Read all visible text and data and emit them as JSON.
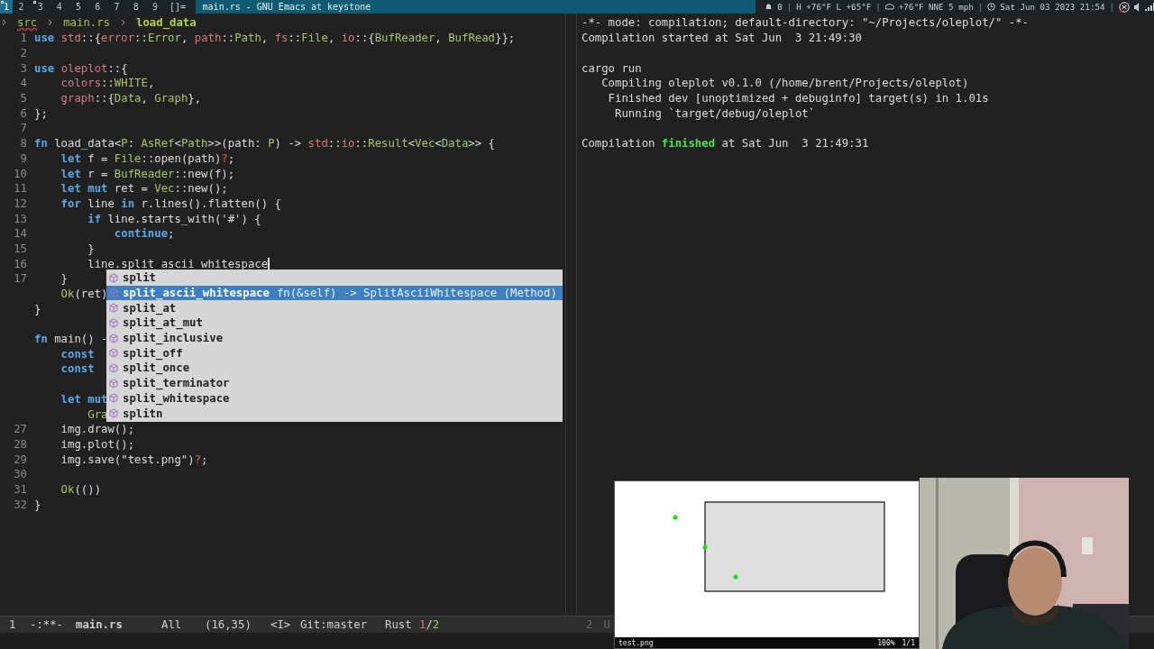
{
  "topbar": {
    "workspaces": [
      {
        "label": "1",
        "selected": true,
        "occupied": true
      },
      {
        "label": "2",
        "selected": false,
        "occupied": false
      },
      {
        "label": "3",
        "selected": false,
        "occupied": true
      },
      {
        "label": "4",
        "selected": false,
        "occupied": false
      },
      {
        "label": "5",
        "selected": false,
        "occupied": false
      },
      {
        "label": "6",
        "selected": false,
        "occupied": false
      },
      {
        "label": "7",
        "selected": false,
        "occupied": false
      },
      {
        "label": "8",
        "selected": false,
        "occupied": false
      },
      {
        "label": "9",
        "selected": false,
        "occupied": false
      }
    ],
    "layout": "[]=",
    "window_title": "main.rs - GNU Emacs at keystone",
    "status": [
      {
        "kind": "text",
        "text": "0"
      },
      {
        "kind": "sep",
        "text": "|"
      },
      {
        "kind": "text",
        "text": "H +76°F L +65°F"
      },
      {
        "kind": "sep",
        "text": "|"
      },
      {
        "kind": "text",
        "text": "+76°F NNE 5 mph"
      },
      {
        "kind": "sep",
        "text": "|"
      },
      {
        "kind": "text",
        "text": "Sat Jun 03 2023 21:54"
      },
      {
        "kind": "sep",
        "text": "|"
      }
    ]
  },
  "editor": {
    "breadcrumb": [
      {
        "text": "src",
        "error": true,
        "current": false
      },
      {
        "text": "main.rs",
        "error": false,
        "current": false
      },
      {
        "text": "load_data",
        "error": false,
        "current": true
      }
    ],
    "blocks": [
      [
        {
          "number": "1",
          "segments": [
            {
              "kind": "kw",
              "text": "use "
            },
            {
              "kind": "ns",
              "text": "std"
            },
            {
              "kind": "plain",
              "text": "::{"
            },
            {
              "kind": "ns",
              "text": "error"
            },
            {
              "kind": "plain",
              "text": "::"
            },
            {
              "kind": "ty",
              "text": "Error"
            },
            {
              "kind": "plain",
              "text": ", "
            },
            {
              "kind": "ns",
              "text": "path"
            },
            {
              "kind": "plain",
              "text": "::"
            },
            {
              "kind": "ty",
              "text": "Path"
            },
            {
              "kind": "plain",
              "text": ", "
            },
            {
              "kind": "ns",
              "text": "fs"
            },
            {
              "kind": "plain",
              "text": "::"
            },
            {
              "kind": "ty",
              "text": "File"
            },
            {
              "kind": "plain",
              "text": ", "
            },
            {
              "kind": "ns",
              "text": "io"
            },
            {
              "kind": "plain",
              "text": "::{"
            },
            {
              "kind": "ty",
              "text": "BufReader"
            },
            {
              "kind": "plain",
              "text": ", "
            },
            {
              "kind": "ty",
              "text": "BufRead"
            },
            {
              "kind": "plain",
              "text": "}};"
            }
          ]
        },
        {
          "number": "2"
        },
        {
          "number": "3",
          "segments": [
            {
              "kind": "kw",
              "text": "use "
            },
            {
              "kind": "ns",
              "text": "oleplot"
            },
            {
              "kind": "plain",
              "text": "::{"
            }
          ]
        },
        {
          "number": "4",
          "segments": [
            {
              "kind": "ns",
              "text": "    colors"
            },
            {
              "kind": "plain",
              "text": "::"
            },
            {
              "kind": "ty",
              "text": "WHITE"
            },
            {
              "kind": "plain",
              "text": ","
            }
          ]
        },
        {
          "number": "5",
          "segments": [
            {
              "kind": "ns",
              "text": "    graph"
            },
            {
              "kind": "plain",
              "text": "::{"
            },
            {
              "kind": "ty",
              "text": "Data"
            },
            {
              "kind": "plain",
              "text": ", "
            },
            {
              "kind": "ty",
              "text": "Graph"
            },
            {
              "kind": "plain",
              "text": "},"
            }
          ]
        },
        {
          "number": "6",
          "segments": [
            {
              "kind": "plain",
              "text": "};"
            }
          ]
        },
        {
          "number": "7"
        },
        {
          "number": "8",
          "segments": [
            {
              "kind": "kw",
              "text": "fn"
            },
            {
              "kind": "plain",
              "text": " load_data<"
            },
            {
              "kind": "ty",
              "text": "P"
            },
            {
              "kind": "plain",
              "text": ": "
            },
            {
              "kind": "ty",
              "text": "AsRef"
            },
            {
              "kind": "plain",
              "text": "<"
            },
            {
              "kind": "ty",
              "text": "Path"
            },
            {
              "kind": "plain",
              "text": ">>(path: "
            },
            {
              "kind": "ty",
              "text": "P"
            },
            {
              "kind": "plain",
              "text": ") -> "
            },
            {
              "kind": "ns",
              "text": "std"
            },
            {
              "kind": "plain",
              "text": "::"
            },
            {
              "kind": "ns",
              "text": "io"
            },
            {
              "kind": "plain",
              "text": "::"
            },
            {
              "kind": "ty",
              "text": "Result"
            },
            {
              "kind": "plain",
              "text": "<"
            },
            {
              "kind": "ty",
              "text": "Vec"
            },
            {
              "kind": "plain",
              "text": "<"
            },
            {
              "kind": "ty",
              "text": "Data"
            },
            {
              "kind": "plain",
              "text": ">> {"
            }
          ]
        },
        {
          "number": "9",
          "segments": [
            {
              "kind": "kw",
              "text": "    let"
            },
            {
              "kind": "plain",
              "text": " f = "
            },
            {
              "kind": "ty",
              "text": "File"
            },
            {
              "kind": "plain",
              "text": "::open(path)"
            },
            {
              "kind": "op",
              "text": "?"
            },
            {
              "kind": "plain",
              "text": ";"
            }
          ]
        },
        {
          "number": "10",
          "segments": [
            {
              "kind": "kw",
              "text": "    let"
            },
            {
              "kind": "plain",
              "text": " r = "
            },
            {
              "kind": "ty",
              "text": "BufReader"
            },
            {
              "kind": "plain",
              "text": "::new(f);"
            }
          ]
        },
        {
          "number": "11",
          "segments": [
            {
              "kind": "kw",
              "text": "    let mut"
            },
            {
              "kind": "plain",
              "text": " ret = "
            },
            {
              "kind": "ty",
              "text": "Vec"
            },
            {
              "kind": "plain",
              "text": "::new();"
            }
          ]
        },
        {
          "number": "12",
          "segments": [
            {
              "kind": "kw",
              "text": "    for"
            },
            {
              "kind": "plain",
              "text": " line "
            },
            {
              "kind": "kw",
              "text": "in"
            },
            {
              "kind": "plain",
              "text": " r.lines().flatten() {"
            }
          ]
        },
        {
          "number": "13",
          "segments": [
            {
              "kind": "kw",
              "text": "        if"
            },
            {
              "kind": "plain",
              "text": " line.starts_with('#') {"
            }
          ]
        },
        {
          "number": "14",
          "segments": [
            {
              "kind": "kw",
              "text": "            continue"
            },
            {
              "kind": "plain",
              "text": ";"
            }
          ]
        },
        {
          "number": "15",
          "segments": [
            {
              "kind": "plain",
              "text": "        }"
            }
          ]
        },
        {
          "number": "16",
          "cursor": true,
          "segments": [
            {
              "kind": "plain",
              "text": "        line.split_ascii_whitespace"
            }
          ]
        },
        {
          "number": "17",
          "segments": [
            {
              "kind": "plain",
              "text": "    }"
            }
          ]
        },
        {
          "segments": [
            {
              "kind": "ty",
              "text": "    Ok"
            },
            {
              "kind": "plain",
              "text": "(ret)"
            }
          ]
        },
        {
          "segments": [
            {
              "kind": "plain",
              "text": "}"
            }
          ]
        }
      ],
      [
        {
          "segments": [
            {
              "kind": "kw",
              "text": "fn"
            },
            {
              "kind": "plain",
              "text": " main() -"
            }
          ]
        },
        {
          "segments": [
            {
              "kind": "kw",
              "text": "    const"
            }
          ]
        },
        {
          "segments": [
            {
              "kind": "kw",
              "text": "    const"
            }
          ]
        }
      ],
      [
        {
          "segments": [
            {
              "kind": "kw",
              "text": "    let mut"
            }
          ]
        },
        {
          "segments": [
            {
              "kind": "ty",
              "text": "        Gra"
            }
          ]
        },
        {
          "number": "27",
          "segments": [
            {
              "kind": "plain",
              "text": "    img.draw();"
            }
          ]
        },
        {
          "number": "28",
          "segments": [
            {
              "kind": "plain",
              "text": "    img.plot();"
            }
          ]
        },
        {
          "number": "29",
          "segments": [
            {
              "kind": "plain",
              "text": "    img.save(\"test.png\")"
            },
            {
              "kind": "op",
              "text": "?"
            },
            {
              "kind": "plain",
              "text": ";"
            }
          ]
        },
        {
          "number": "30"
        },
        {
          "number": "31",
          "segments": [
            {
              "kind": "ty",
              "text": "    Ok"
            },
            {
              "kind": "plain",
              "text": "(())"
            }
          ]
        },
        {
          "number": "32",
          "segments": [
            {
              "kind": "plain",
              "text": "}"
            }
          ]
        }
      ]
    ],
    "completions": [
      {
        "label": "split",
        "selected": false
      },
      {
        "label": "split_ascii_whitespace",
        "detail": "fn(&self) -> SplitAsciiWhitespace (Method)",
        "selected": true
      },
      {
        "label": "split_at",
        "selected": false
      },
      {
        "label": "split_at_mut",
        "selected": false
      },
      {
        "label": "split_inclusive",
        "selected": false
      },
      {
        "label": "split_off",
        "selected": false
      },
      {
        "label": "split_once",
        "selected": false
      },
      {
        "label": "split_terminator",
        "selected": false
      },
      {
        "label": "split_whitespace",
        "selected": false
      },
      {
        "label": "splitn",
        "selected": false
      }
    ]
  },
  "compilation": {
    "blocks": [
      [
        {
          "segments": [
            {
              "kind": "plain",
              "text": "-*- mode: compilation; default-directory: \"~/Projects/oleplot/\" -*-"
            }
          ]
        },
        {
          "segments": [
            {
              "kind": "plain",
              "text": "Compilation started at Sat Jun  3 21:49:30"
            }
          ]
        }
      ],
      [
        {
          "segments": [
            {
              "kind": "plain",
              "text": "cargo run"
            }
          ]
        },
        {
          "segments": [
            {
              "kind": "plain",
              "text": "   Compiling oleplot v0.1.0 (/home/brent/Projects/oleplot)"
            }
          ]
        },
        {
          "segments": [
            {
              "kind": "plain",
              "text": "    Finished dev [unoptimized + debuginfo] target(s) in 1.01s"
            }
          ]
        },
        {
          "segments": [
            {
              "kind": "plain",
              "text": "     Running `target/debug/oleplot`"
            }
          ]
        }
      ],
      [
        {
          "segments": [
            {
              "kind": "plain",
              "text": "Compilation "
            },
            {
              "kind": "success",
              "text": "finished"
            },
            {
              "kind": "plain",
              "text": " at Sat Jun  3 21:49:31"
            }
          ]
        }
      ]
    ]
  },
  "mode_line": {
    "items": [
      "1",
      "-:**-",
      "main.rs",
      "All",
      "(16,35)",
      "<I>",
      "Git:master",
      "Rust"
    ],
    "counter": {
      "first": "1",
      "sep": "/",
      "second": "2"
    },
    "right_items": [
      "2",
      "U"
    ]
  },
  "image_viewer": {
    "file": "test.png",
    "zoom": "100%",
    "page": "1/1"
  }
}
